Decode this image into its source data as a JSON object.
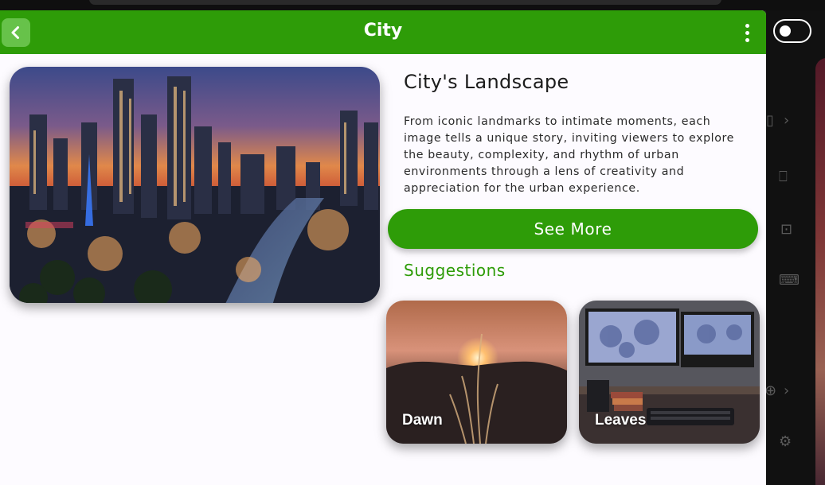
{
  "appbar": {
    "title": "City"
  },
  "hero": {
    "image_name": "city-skyline-at-sunset"
  },
  "content": {
    "heading": "City's Landscape",
    "description": "From iconic landmarks to intimate moments, each image tells a unique story, inviting viewers to explore the beauty, complexity, and rhythm of urban environments through a lens of creativity and appreciation for the urban experience.",
    "see_more_label": "See More",
    "suggestions_heading": "Suggestions"
  },
  "suggestions": [
    {
      "label": "Dawn"
    },
    {
      "label": "Leaves"
    }
  ],
  "colors": {
    "primary": "#2e9c08",
    "back_button": "#67c24a",
    "background": "#fdfbff"
  },
  "icons": {
    "back": "chevron-left-icon",
    "menu": "more-vertical-icon",
    "theme_toggle": "toggle-icon"
  }
}
